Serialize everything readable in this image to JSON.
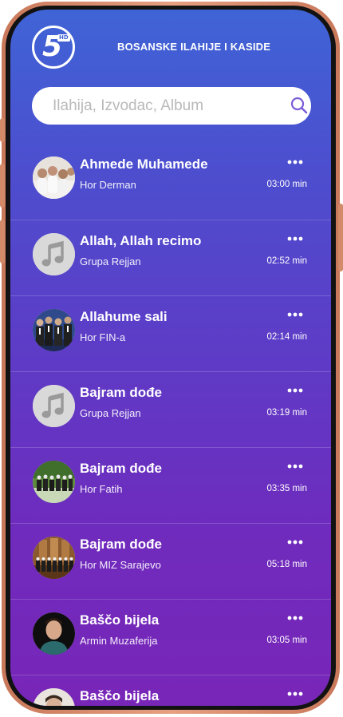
{
  "app": {
    "title": "BOSANSKE ILAHIJE I KASIDE",
    "logo_text": "5",
    "logo_badge": "HD"
  },
  "search": {
    "placeholder": "Ilahija, Izvodac, Album",
    "value": ""
  },
  "colors": {
    "gradient_top": "#3f64d6",
    "gradient_bottom": "#7826b8",
    "frame": "#d99070",
    "accent": "#7a5bd8"
  },
  "songs": [
    {
      "title": "Ahmede Muhamede",
      "artist": "Hor Derman",
      "duration": "03:00 min",
      "avatar": "group-photo",
      "menu_icon": "more-icon"
    },
    {
      "title": "Allah, Allah recimo",
      "artist": "Grupa Rejjan",
      "duration": "02:52 min",
      "avatar": "music-note-placeholder",
      "menu_icon": "more-icon"
    },
    {
      "title": "Allahume sali",
      "artist": "Hor FIN-a",
      "duration": "02:14 min",
      "avatar": "group-photo",
      "menu_icon": "more-icon"
    },
    {
      "title": "Bajram dođe",
      "artist": "Grupa Rejjan",
      "duration": "03:19 min",
      "avatar": "music-note-placeholder",
      "menu_icon": "more-icon"
    },
    {
      "title": "Bajram dođe",
      "artist": "Hor Fatih",
      "duration": "03:35 min",
      "avatar": "group-photo",
      "menu_icon": "more-icon"
    },
    {
      "title": "Bajram dođe",
      "artist": "Hor MIZ Sarajevo",
      "duration": "05:18 min",
      "avatar": "group-photo",
      "menu_icon": "more-icon"
    },
    {
      "title": "Baščo bijela",
      "artist": "Armin Muzaferija",
      "duration": "03:05 min",
      "avatar": "person-photo",
      "menu_icon": "more-icon"
    },
    {
      "title": "Baščo bijela",
      "artist": "",
      "duration": "",
      "avatar": "person-photo",
      "menu_icon": "more-icon"
    }
  ]
}
